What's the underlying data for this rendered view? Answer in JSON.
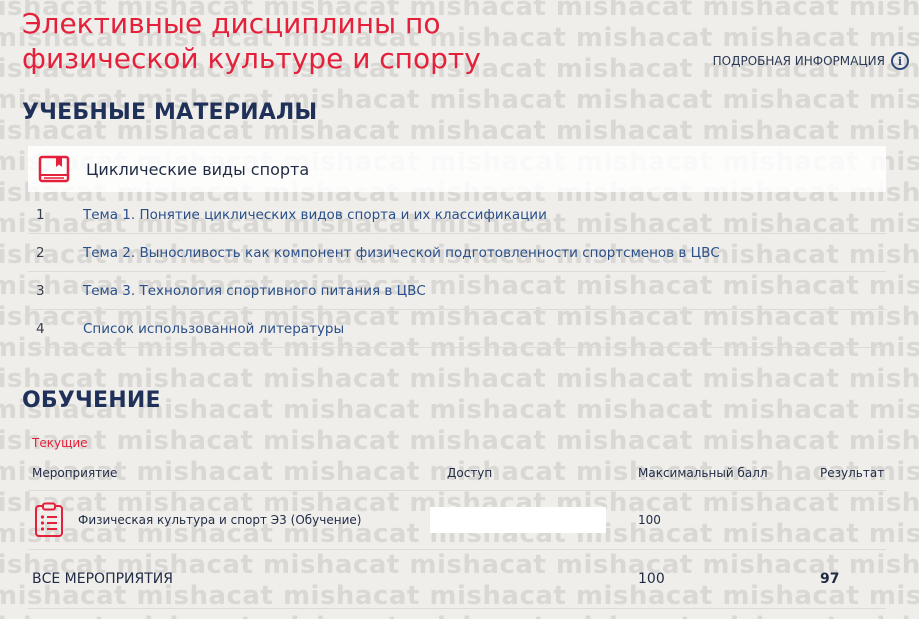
{
  "header": {
    "title": "Элективные дисциплины по физической культуре и спорту",
    "more_info": "ПОДРОБНАЯ ИНФОРМАЦИЯ",
    "info_glyph": "i"
  },
  "materials": {
    "section_title": "УЧЕБНЫЕ МАТЕРИАЛЫ",
    "course_name": "Циклические виды спорта",
    "items": [
      {
        "num": "1",
        "label": "Тема 1. Понятие циклических видов спорта и их классификации"
      },
      {
        "num": "2",
        "label": "Тема 2. Выносливость как компонент физической подготовленности спортсменов в ЦВС"
      },
      {
        "num": "3",
        "label": "Тема 3. Технология спортивного питания в ЦВС"
      },
      {
        "num": "4",
        "label": "Список использованной литературы"
      }
    ]
  },
  "learning": {
    "section_title": "ОБУЧЕНИЕ",
    "tab_current": "Текущие",
    "columns": {
      "event": "Мероприятие",
      "access": "Доступ",
      "max_score": "Максимальный балл",
      "result": "Результат"
    },
    "rows": [
      {
        "event": "Физическая культура и спорт Э3 (Обучение)",
        "access": "",
        "max_score": "100",
        "result": ""
      }
    ],
    "total": {
      "label": "ВСЕ МЕРОПРИЯТИЯ",
      "max_score": "100",
      "result": "97"
    }
  },
  "watermark": "mishacat",
  "colors": {
    "accent_red": "#e4203a",
    "navy": "#1f3158",
    "link": "#2a4f8a",
    "background": "#efeeeb"
  }
}
